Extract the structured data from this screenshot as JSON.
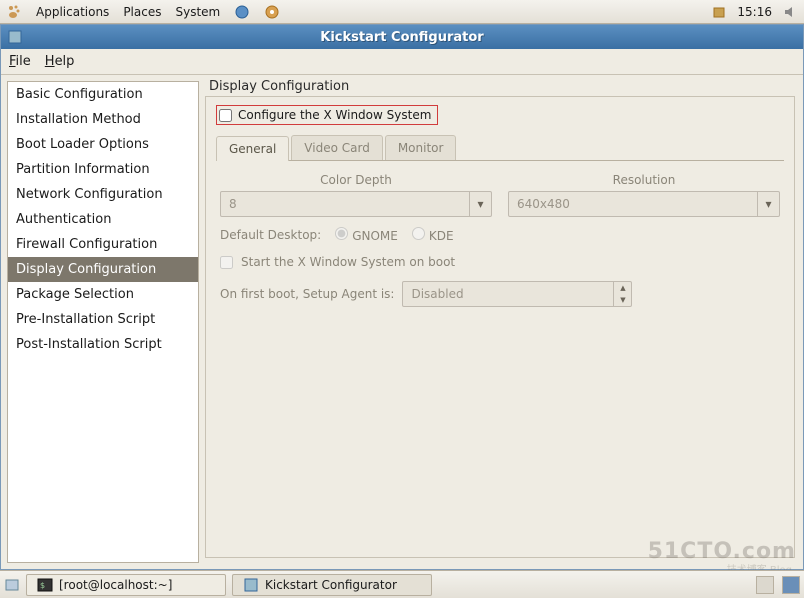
{
  "top_panel": {
    "menus": [
      "Applications",
      "Places",
      "System"
    ],
    "time": "15:16"
  },
  "window": {
    "title": "Kickstart Configurator"
  },
  "menubar": {
    "file": "File",
    "help": "Help"
  },
  "sidebar": {
    "items": [
      {
        "label": "Basic Configuration"
      },
      {
        "label": "Installation Method"
      },
      {
        "label": "Boot Loader Options"
      },
      {
        "label": "Partition Information"
      },
      {
        "label": "Network Configuration"
      },
      {
        "label": "Authentication"
      },
      {
        "label": "Firewall Configuration"
      },
      {
        "label": "Display Configuration",
        "selected": true
      },
      {
        "label": "Package Selection"
      },
      {
        "label": "Pre-Installation Script"
      },
      {
        "label": "Post-Installation Script"
      }
    ]
  },
  "main": {
    "section_title": "Display Configuration",
    "configure_x_label": "Configure the X Window System",
    "tabs": [
      {
        "label": "General",
        "active": true
      },
      {
        "label": "Video Card"
      },
      {
        "label": "Monitor"
      }
    ],
    "color_depth_label": "Color Depth",
    "color_depth_value": "8",
    "resolution_label": "Resolution",
    "resolution_value": "640x480",
    "default_desktop_label": "Default Desktop:",
    "desktop_gnome": "GNOME",
    "desktop_kde": "KDE",
    "start_x_label": "Start the X Window System on boot",
    "setup_agent_label": "On first boot, Setup Agent is:",
    "setup_agent_value": "Disabled"
  },
  "taskbar": {
    "task1": "[root@localhost:~]",
    "task2": "Kickstart Configurator"
  },
  "watermark": {
    "main": "51CTO.com",
    "sub": "技术博客    Blog"
  }
}
